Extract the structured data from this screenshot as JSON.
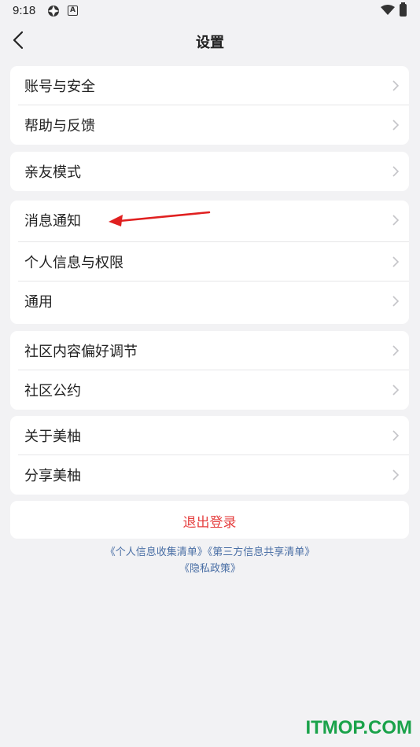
{
  "status": {
    "time": "9:18",
    "icons": [
      "app-icon",
      "a-icon",
      "wifi-icon",
      "battery-icon"
    ]
  },
  "nav": {
    "title": "设置",
    "back_icon": "back-icon"
  },
  "groups": [
    {
      "items": [
        "账号与安全",
        "帮助与反馈"
      ]
    },
    {
      "items": [
        "亲友模式"
      ]
    },
    {
      "items": [
        "消息通知",
        "个人信息与权限",
        "通用"
      ]
    },
    {
      "items": [
        "社区内容偏好调节",
        "社区公约"
      ]
    },
    {
      "items": [
        "关于美柚",
        "分享美柚"
      ]
    }
  ],
  "logout": {
    "label": "退出登录"
  },
  "links": {
    "info_list": "《个人信息收集清单》",
    "third_party": "《第三方信息共享清单》",
    "privacy": "《隐私政策》"
  },
  "watermark": "ITMOP.COM",
  "colors": {
    "logout_text": "#e53e3e",
    "link_text": "#4a6fa5",
    "background": "#f2f2f4",
    "annotation_arrow": "#e02020",
    "watermark": "#1aa24a"
  }
}
